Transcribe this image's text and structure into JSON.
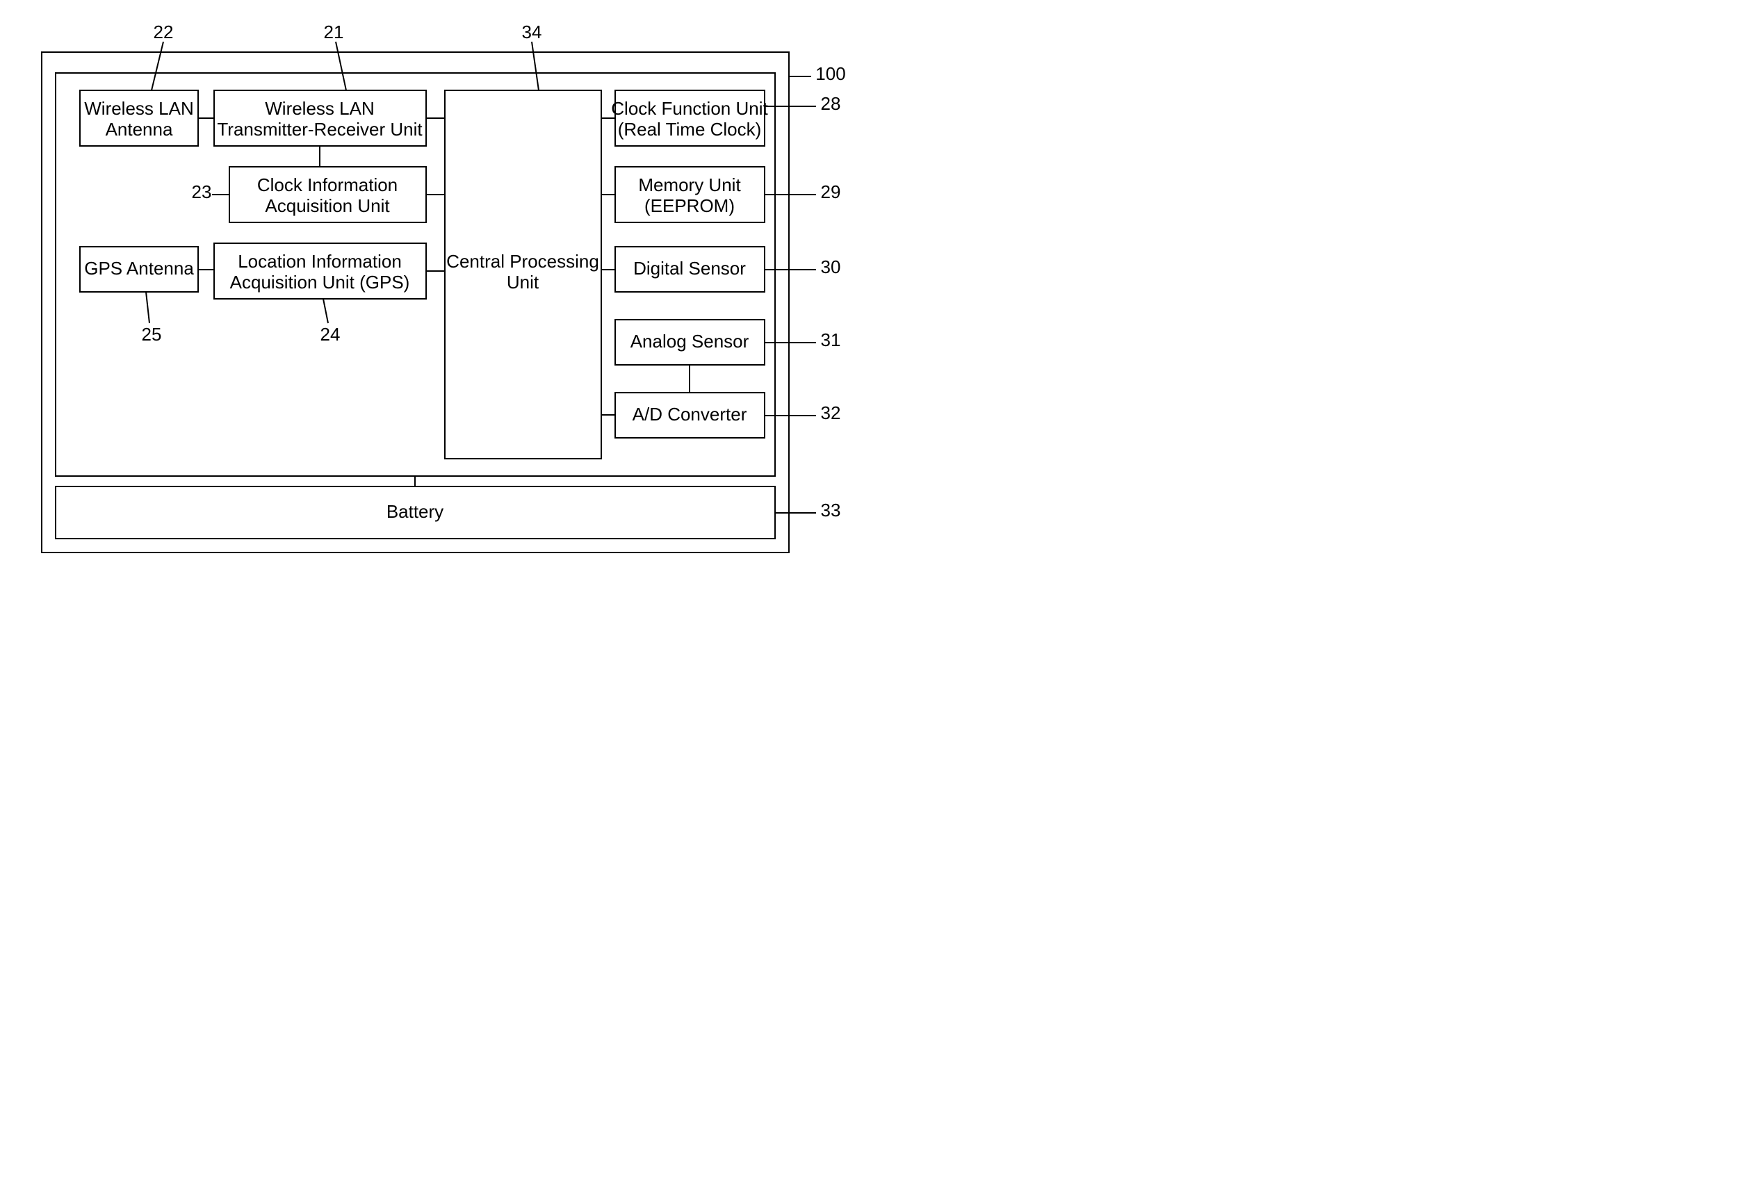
{
  "labels": {
    "100": "100",
    "21": "21",
    "22": "22",
    "23": "23",
    "24": "24",
    "25": "25",
    "28": "28",
    "29": "29",
    "30": "30",
    "31": "31",
    "32": "32",
    "33": "33",
    "34": "34"
  },
  "blocks": {
    "wlan_ant_1": "Wireless LAN",
    "wlan_ant_2": "Antenna",
    "wlan_trx_1": "Wireless LAN",
    "wlan_trx_2": "Transmitter-Receiver Unit",
    "clk_info_1": "Clock Information",
    "clk_info_2": "Acquisition Unit",
    "gps_ant": "GPS Antenna",
    "loc_1": "Location Information",
    "loc_2": "Acquisition Unit (GPS)",
    "cpu_1": "Central Processing",
    "cpu_2": "Unit",
    "rtc_1": "Clock Function Unit",
    "rtc_2": "(Real Time Clock)",
    "mem_1": "Memory Unit",
    "mem_2": "(EEPROM)",
    "dsens": "Digital Sensor",
    "asens": "Analog Sensor",
    "adc": "A/D Converter",
    "batt": "Battery"
  }
}
